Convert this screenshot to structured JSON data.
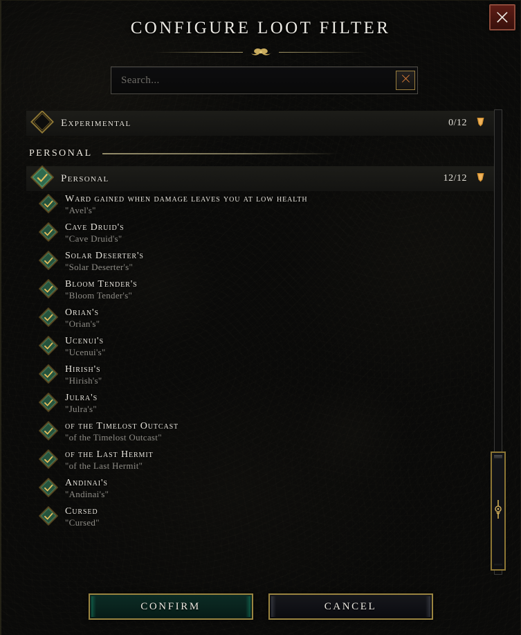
{
  "window": {
    "title": "CONFIGURE LOOT FILTER",
    "close_icon": "close-x-icon",
    "ornament_icon": "ornament-flourish-icon"
  },
  "search": {
    "value": "",
    "placeholder": "Search...",
    "clear_icon": "clear-x-icon"
  },
  "groups": [
    {
      "label": "Experimental",
      "count": "0/12",
      "checked": false,
      "chevron_icon": "chevron-down-icon",
      "checkbox_icon": "diamond-unchecked-icon"
    }
  ],
  "sections": [
    {
      "title": "PERSONAL",
      "group": {
        "label": "Personal",
        "count": "12/12",
        "checked": true,
        "chevron_icon": "chevron-down-icon",
        "checkbox_icon": "diamond-checked-icon"
      },
      "items": [
        {
          "title": "Ward gained when damage leaves you at low health",
          "subtitle": "\"Avel's\"",
          "checked": true
        },
        {
          "title": "Cave Druid's",
          "subtitle": "\"Cave Druid's\"",
          "checked": true
        },
        {
          "title": "Solar Deserter's",
          "subtitle": "\"Solar Deserter's\"",
          "checked": true
        },
        {
          "title": "Bloom Tender's",
          "subtitle": "\"Bloom Tender's\"",
          "checked": true
        },
        {
          "title": "Orian's",
          "subtitle": "\"Orian's\"",
          "checked": true
        },
        {
          "title": "Ucenui's",
          "subtitle": "\"Ucenui's\"",
          "checked": true
        },
        {
          "title": "Hirish's",
          "subtitle": "\"Hirish's\"",
          "checked": true
        },
        {
          "title": "Julra's",
          "subtitle": "\"Julra's\"",
          "checked": true
        },
        {
          "title": "of the Timelost Outcast",
          "subtitle": "\"of the Timelost Outcast\"",
          "checked": true
        },
        {
          "title": "of the Last Hermit",
          "subtitle": "\"of the Last Hermit\"",
          "checked": true
        },
        {
          "title": "Andinai's",
          "subtitle": "\"Andinai's\"",
          "checked": true
        },
        {
          "title": "Cursed",
          "subtitle": "\"Cursed\"",
          "checked": true
        }
      ]
    }
  ],
  "scrollbar": {
    "orientation": "vertical",
    "thumb_position": "bottom",
    "grip_icon": "scroll-grip-icon"
  },
  "footer": {
    "confirm_label": "Confirm",
    "cancel_label": "Cancel"
  },
  "colors": {
    "gold": "#9a8440",
    "gold_bright": "#d8b255",
    "green_check": "#2d5b45",
    "red_close": "#4a1610",
    "background": "#0a0a09",
    "text_primary": "#e8e5dd",
    "text_muted": "#8e8c86"
  }
}
